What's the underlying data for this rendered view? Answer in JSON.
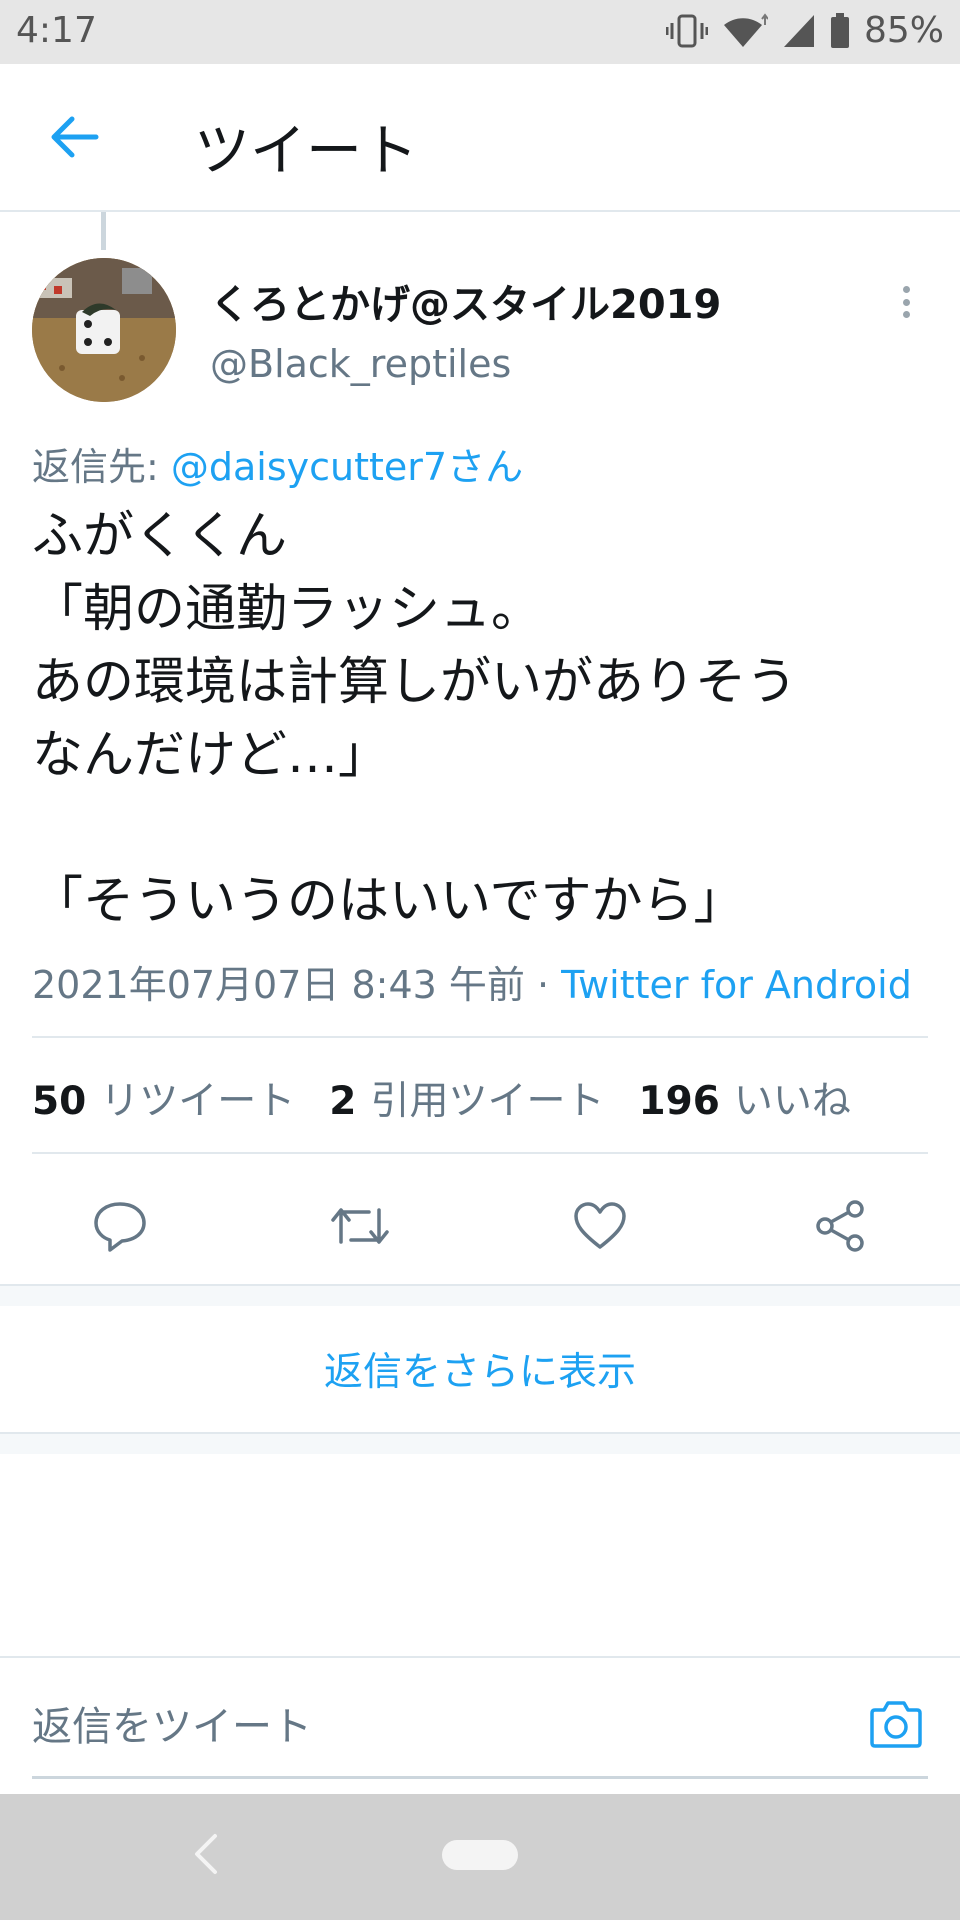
{
  "status_bar": {
    "time": "4:17",
    "battery": "85%",
    "icons": [
      "vibrate-icon",
      "wifi-icon",
      "signal-icon",
      "battery-icon"
    ]
  },
  "app_bar": {
    "title": "ツイート",
    "back_icon": "arrow-left-icon"
  },
  "tweet": {
    "author": {
      "display_name": "くろとかげ@スタイル2019",
      "handle": "@Black_reptiles"
    },
    "reply_to": {
      "label": "返信先: ",
      "mention": "@daisycutter7さん"
    },
    "text": "ふがくくん\n「朝の通勤ラッシュ。\nあの環境は計算しがいがありそう\nなんだけど…」\n\n「そういうのはいいですから」",
    "timestamp": "2021年07月07日 8:43 午前",
    "separator": " · ",
    "source": "Twitter for Android",
    "stats": {
      "retweets_count": "50",
      "retweets_label": "リツイート",
      "quotes_count": "2",
      "quotes_label": "引用ツイート",
      "likes_count": "196",
      "likes_label": "いいね"
    },
    "actions": [
      "reply-icon",
      "retweet-icon",
      "like-icon",
      "share-icon"
    ]
  },
  "show_more_replies": "返信をさらに表示",
  "compose": {
    "placeholder": "返信をツイート",
    "camera_icon": "camera-icon"
  },
  "colors": {
    "accent": "#1da1f2",
    "text": "#14171a",
    "secondary_text": "#657786",
    "divider": "#e1e8ed"
  }
}
